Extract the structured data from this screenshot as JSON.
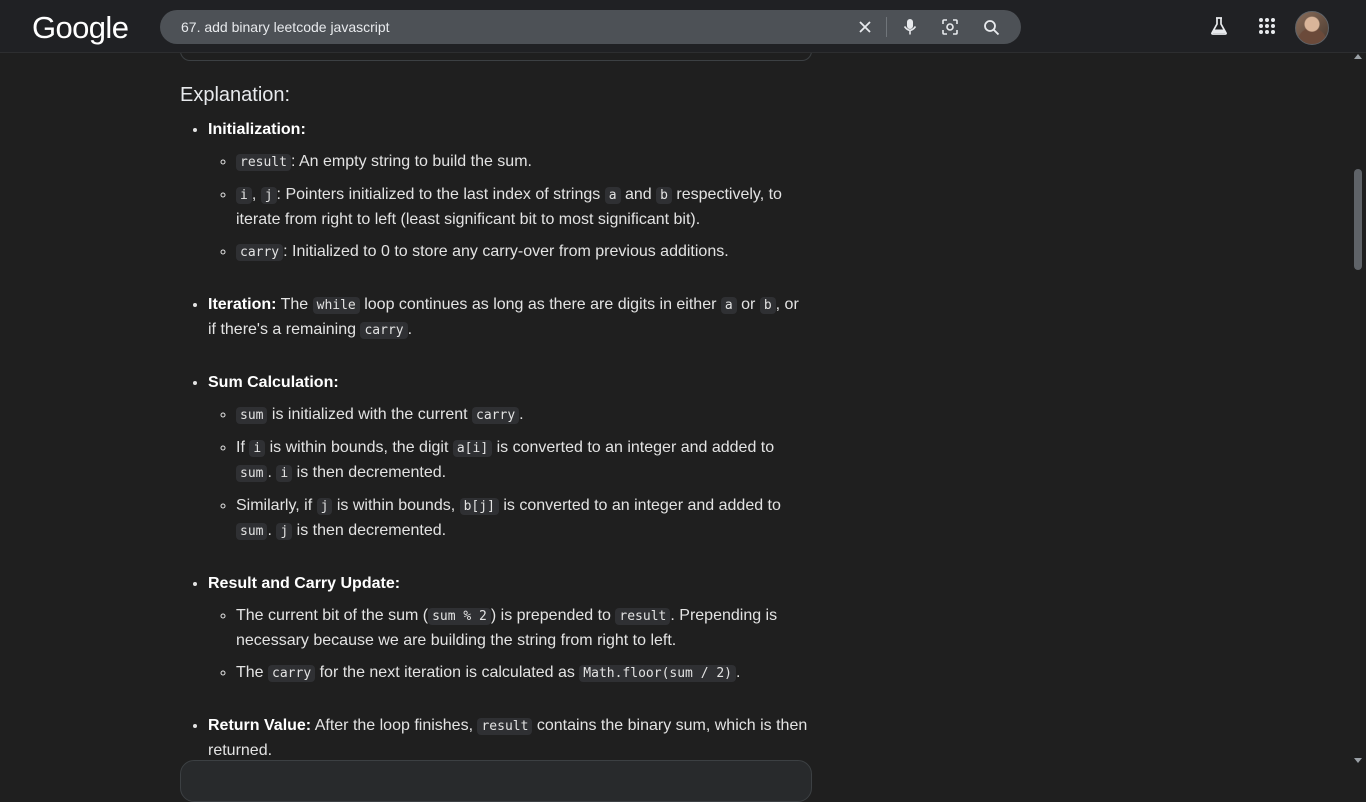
{
  "header": {
    "logo": "Google",
    "query": "67. add binary leetcode javascript"
  },
  "explanation": {
    "heading": "Explanation:",
    "init": {
      "title": "Initialization:",
      "items": [
        {
          "code": "result",
          "text": ": An empty string to build the sum."
        },
        {
          "code1": "i",
          "sep": ", ",
          "code2": "j",
          "text1": ": Pointers initialized to the last index of strings ",
          "code3": "a",
          "text2": " and ",
          "code4": "b",
          "text3": " respectively, to iterate from right to left (least significant bit to most significant bit)."
        },
        {
          "code": "carry",
          "text": ": Initialized to 0 to store any carry-over from previous additions."
        }
      ]
    },
    "iteration": {
      "title": "Iteration:",
      "text1": " The ",
      "code1": "while",
      "text2": " loop continues as long as there are digits in either ",
      "code2": "a",
      "text3": " or ",
      "code3": "b",
      "text4": ", or if there's a remaining ",
      "code4": "carry",
      "text5": "."
    },
    "sum": {
      "title": "Sum Calculation:",
      "item1": {
        "code1": "sum",
        "text1": " is initialized with the current ",
        "code2": "carry",
        "text2": "."
      },
      "item2": {
        "text1": "If ",
        "code1": "i",
        "text2": " is within bounds, the digit ",
        "code2": "a[i]",
        "text3": " is converted to an integer and added to ",
        "code3": "sum",
        "text4": ". ",
        "code4": "i",
        "text5": " is then decremented."
      },
      "item3": {
        "text1": "Similarly, if ",
        "code1": "j",
        "text2": " is within bounds, ",
        "code2": "b[j]",
        "text3": " is converted to an integer and added to ",
        "code3": "sum",
        "text4": ". ",
        "code4": "j",
        "text5": " is then decremented."
      }
    },
    "result_update": {
      "title": "Result and Carry Update:",
      "item1": {
        "text1": "The current bit of the sum (",
        "code1": "sum % 2",
        "text2": ") is prepended to ",
        "code2": "result",
        "text3": ". Prepending is necessary because we are building the string from right to left."
      },
      "item2": {
        "text1": "The ",
        "code1": "carry",
        "text2": " for the next iteration is calculated as ",
        "code2": "Math.floor(sum / 2)",
        "text3": "."
      }
    },
    "return_value": {
      "title": "Return Value:",
      "text1": " After the loop finishes, ",
      "code1": "result",
      "text2": " contains the binary sum, which is then returned."
    }
  }
}
